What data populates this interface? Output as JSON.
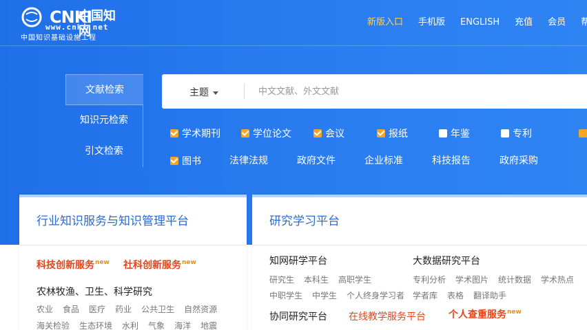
{
  "brand": {
    "word": "CNKI",
    "cn": "中国知网",
    "url": "www.cnki.net",
    "tagline": "中国知识基础设施工程",
    "accent": "#ffcf5a",
    "hero_color": "#2a7df0"
  },
  "topnav": [
    {
      "label": "新版入口",
      "active": true
    },
    {
      "label": "手机版"
    },
    {
      "label": "ENGLISH"
    },
    {
      "label": "充值"
    },
    {
      "label": "会员"
    },
    {
      "label": "帮助"
    }
  ],
  "sidetabs": [
    "文献检索",
    "知识元检索",
    "引文检索"
  ],
  "search": {
    "scope": "主题",
    "placeholder": "中文文献、外文文献"
  },
  "types_row1": [
    {
      "label": "学术期刊",
      "checked": true
    },
    {
      "label": "学位论文",
      "checked": true
    },
    {
      "label": "会议",
      "checked": true
    },
    {
      "label": "报纸",
      "checked": true
    },
    {
      "label": "年鉴",
      "checked": false
    },
    {
      "label": "专利",
      "checked": false
    }
  ],
  "types_row2": [
    {
      "label": "图书",
      "checked": true
    },
    {
      "label": "法律法规"
    },
    {
      "label": "政府文件"
    },
    {
      "label": "企业标准"
    },
    {
      "label": "科技报告"
    },
    {
      "label": "政府采购"
    }
  ],
  "left_card": {
    "title": "行业知识服务与知识管理平台",
    "hot1": "科技创新服务",
    "hot2": "社科创新服务",
    "new_badge": "new",
    "section": "农林牧渔、卫生、科学研究",
    "tags1": [
      "农业",
      "食品",
      "医疗",
      "药业",
      "公共卫生",
      "自然资源"
    ],
    "tags2": [
      "海关检验",
      "生态环境",
      "水利",
      "气象",
      "海洋",
      "地震"
    ]
  },
  "right_card": {
    "title": "研究学习平台",
    "col1_title": "知网研学平台",
    "col1_tags1": [
      "研究生",
      "本科生",
      "高职学生"
    ],
    "col1_tags2": [
      "中职学生",
      "中学生",
      "个人终身学习者"
    ],
    "col2_title": "大数据研究平台",
    "col2_tags1": [
      "专利分析",
      "学术图片",
      "统计数据",
      "学术热点"
    ],
    "col2_tags2": [
      "学者库",
      "表格",
      "翻译助手"
    ],
    "row3_a": "协同研究平台",
    "row3_b": "在线教学服务平台",
    "row3_c": "个人查重服务",
    "new_badge": "new"
  }
}
